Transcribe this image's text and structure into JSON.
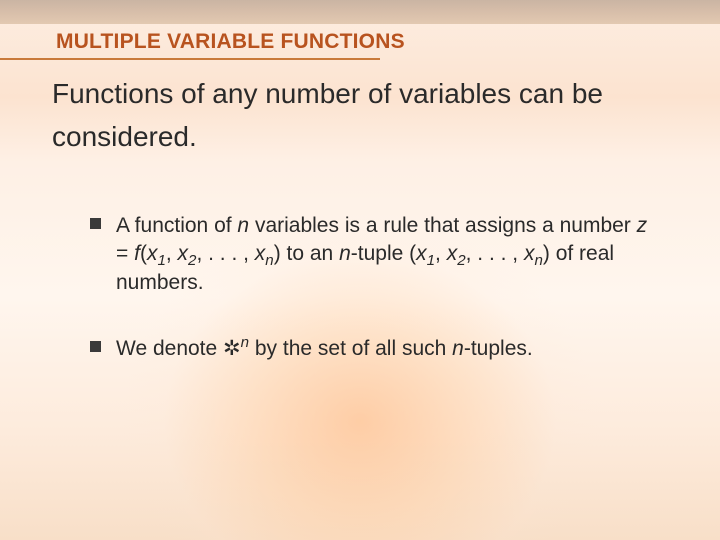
{
  "heading": "MULTIPLE VARIABLE FUNCTIONS",
  "intro": "Functions of any number of variables can be considered.",
  "bullets": {
    "b1": {
      "t1": "A function of ",
      "n1": "n",
      "t2": " variables is a rule that assigns a number ",
      "z": "z",
      "eq": " = ",
      "f": "f",
      "lp": "(",
      "x1": "x",
      "s1": "1",
      "c1": ", ",
      "x2": "x",
      "s2": "2",
      "c2": ", . . . , ",
      "xn": "x",
      "sn": "n",
      "rp": ") to an ",
      "n2": "n",
      "t3": "-tuple (",
      "x1b": "x",
      "s1b": "1",
      "c1b": ", ",
      "x2b": "x",
      "s2b": "2",
      "c2b": ", . . . , ",
      "xnb": "x",
      "snb": "n",
      "t4": ") of real numbers."
    },
    "b2": {
      "t1": "We denote ",
      "r": "✲",
      "n": "n",
      "t2": " by the set of all such ",
      "n2": "n",
      "t3": "-tuples."
    }
  }
}
